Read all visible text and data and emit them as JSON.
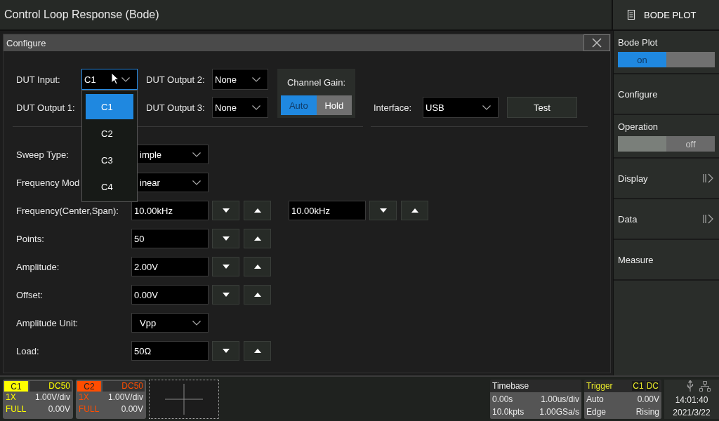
{
  "window": {
    "title": "Control Loop Response (Bode)"
  },
  "menu_header": {
    "label": "BODE PLOT"
  },
  "dialog": {
    "title": "Configure"
  },
  "inputs": {
    "dut_input": {
      "label": "DUT Input:",
      "value": "C1",
      "expanded": true,
      "options": [
        {
          "label": "C1",
          "selected": true
        },
        {
          "label": "C2",
          "selected": false
        },
        {
          "label": "C3",
          "selected": false
        },
        {
          "label": "C4",
          "selected": false
        }
      ]
    },
    "dut_output_1": {
      "label": "DUT Output 1:"
    },
    "dut_output_2": {
      "label": "DUT Output 2:",
      "value": "None"
    },
    "dut_output_3": {
      "label": "DUT Output 3:",
      "value": "None"
    },
    "channel_gain": {
      "label": "Channel Gain:",
      "options": [
        {
          "label": "Auto",
          "selected": true
        },
        {
          "label": "Hold",
          "selected": false
        }
      ]
    },
    "interface": {
      "label": "Interface:",
      "value": "USB"
    },
    "test_button": "Test"
  },
  "settings": [
    {
      "kind": "select",
      "label": "Sweep Type:",
      "value": "imple"
    },
    {
      "kind": "select",
      "label": "Frequency Mod",
      "value": "inear"
    },
    {
      "kind": "spin",
      "label": "Frequency(Center,Span):",
      "values": [
        "10.00kHz",
        "10.00kHz"
      ]
    },
    {
      "kind": "spin",
      "label": "Points:",
      "values": [
        "50"
      ]
    },
    {
      "kind": "spin",
      "label": "Amplitude:",
      "values": [
        "2.00V"
      ]
    },
    {
      "kind": "spin",
      "label": "Offset:",
      "values": [
        "0.00V"
      ]
    },
    {
      "kind": "select",
      "label": "Amplitude Unit:",
      "value": "Vpp"
    },
    {
      "kind": "spin",
      "label": "Load:",
      "values": [
        "50Ω"
      ]
    }
  ],
  "sidebar": {
    "items": [
      {
        "kind": "toggle",
        "label": "Bode Plot",
        "on": true,
        "state_text": "on"
      },
      {
        "kind": "button",
        "label": "Configure"
      },
      {
        "kind": "toggle",
        "label": "Operation",
        "on": false,
        "state_text": "off"
      },
      {
        "kind": "submenu",
        "label": "Display"
      },
      {
        "kind": "submenu",
        "label": "Data"
      },
      {
        "kind": "button",
        "label": "Measure"
      }
    ]
  },
  "channels": [
    {
      "name": "C1",
      "coupling": "DC50",
      "probe": "1X",
      "scale": "1.00V/div",
      "bandwidth": "FULL",
      "offset": "0.00V",
      "color": "#ffff00"
    },
    {
      "name": "C2",
      "coupling": "DC50",
      "probe": "1X",
      "scale": "1.00V/div",
      "bandwidth": "FULL",
      "offset": "0.00V",
      "color": "#ff4d00"
    }
  ],
  "timebase": {
    "title": "Timebase",
    "delay": "0.00s",
    "scale": "1.00us/div",
    "memory": "10.0kpts",
    "sample_rate": "1.00GSa/s"
  },
  "trigger": {
    "title": "Trigger",
    "source": "C1",
    "coupling": "DC",
    "mode": "Auto",
    "trigger_level": "0.00V",
    "type": "Edge",
    "slope": "Rising"
  },
  "status": {
    "time": "14:01:40",
    "date": "2021/3/22"
  }
}
